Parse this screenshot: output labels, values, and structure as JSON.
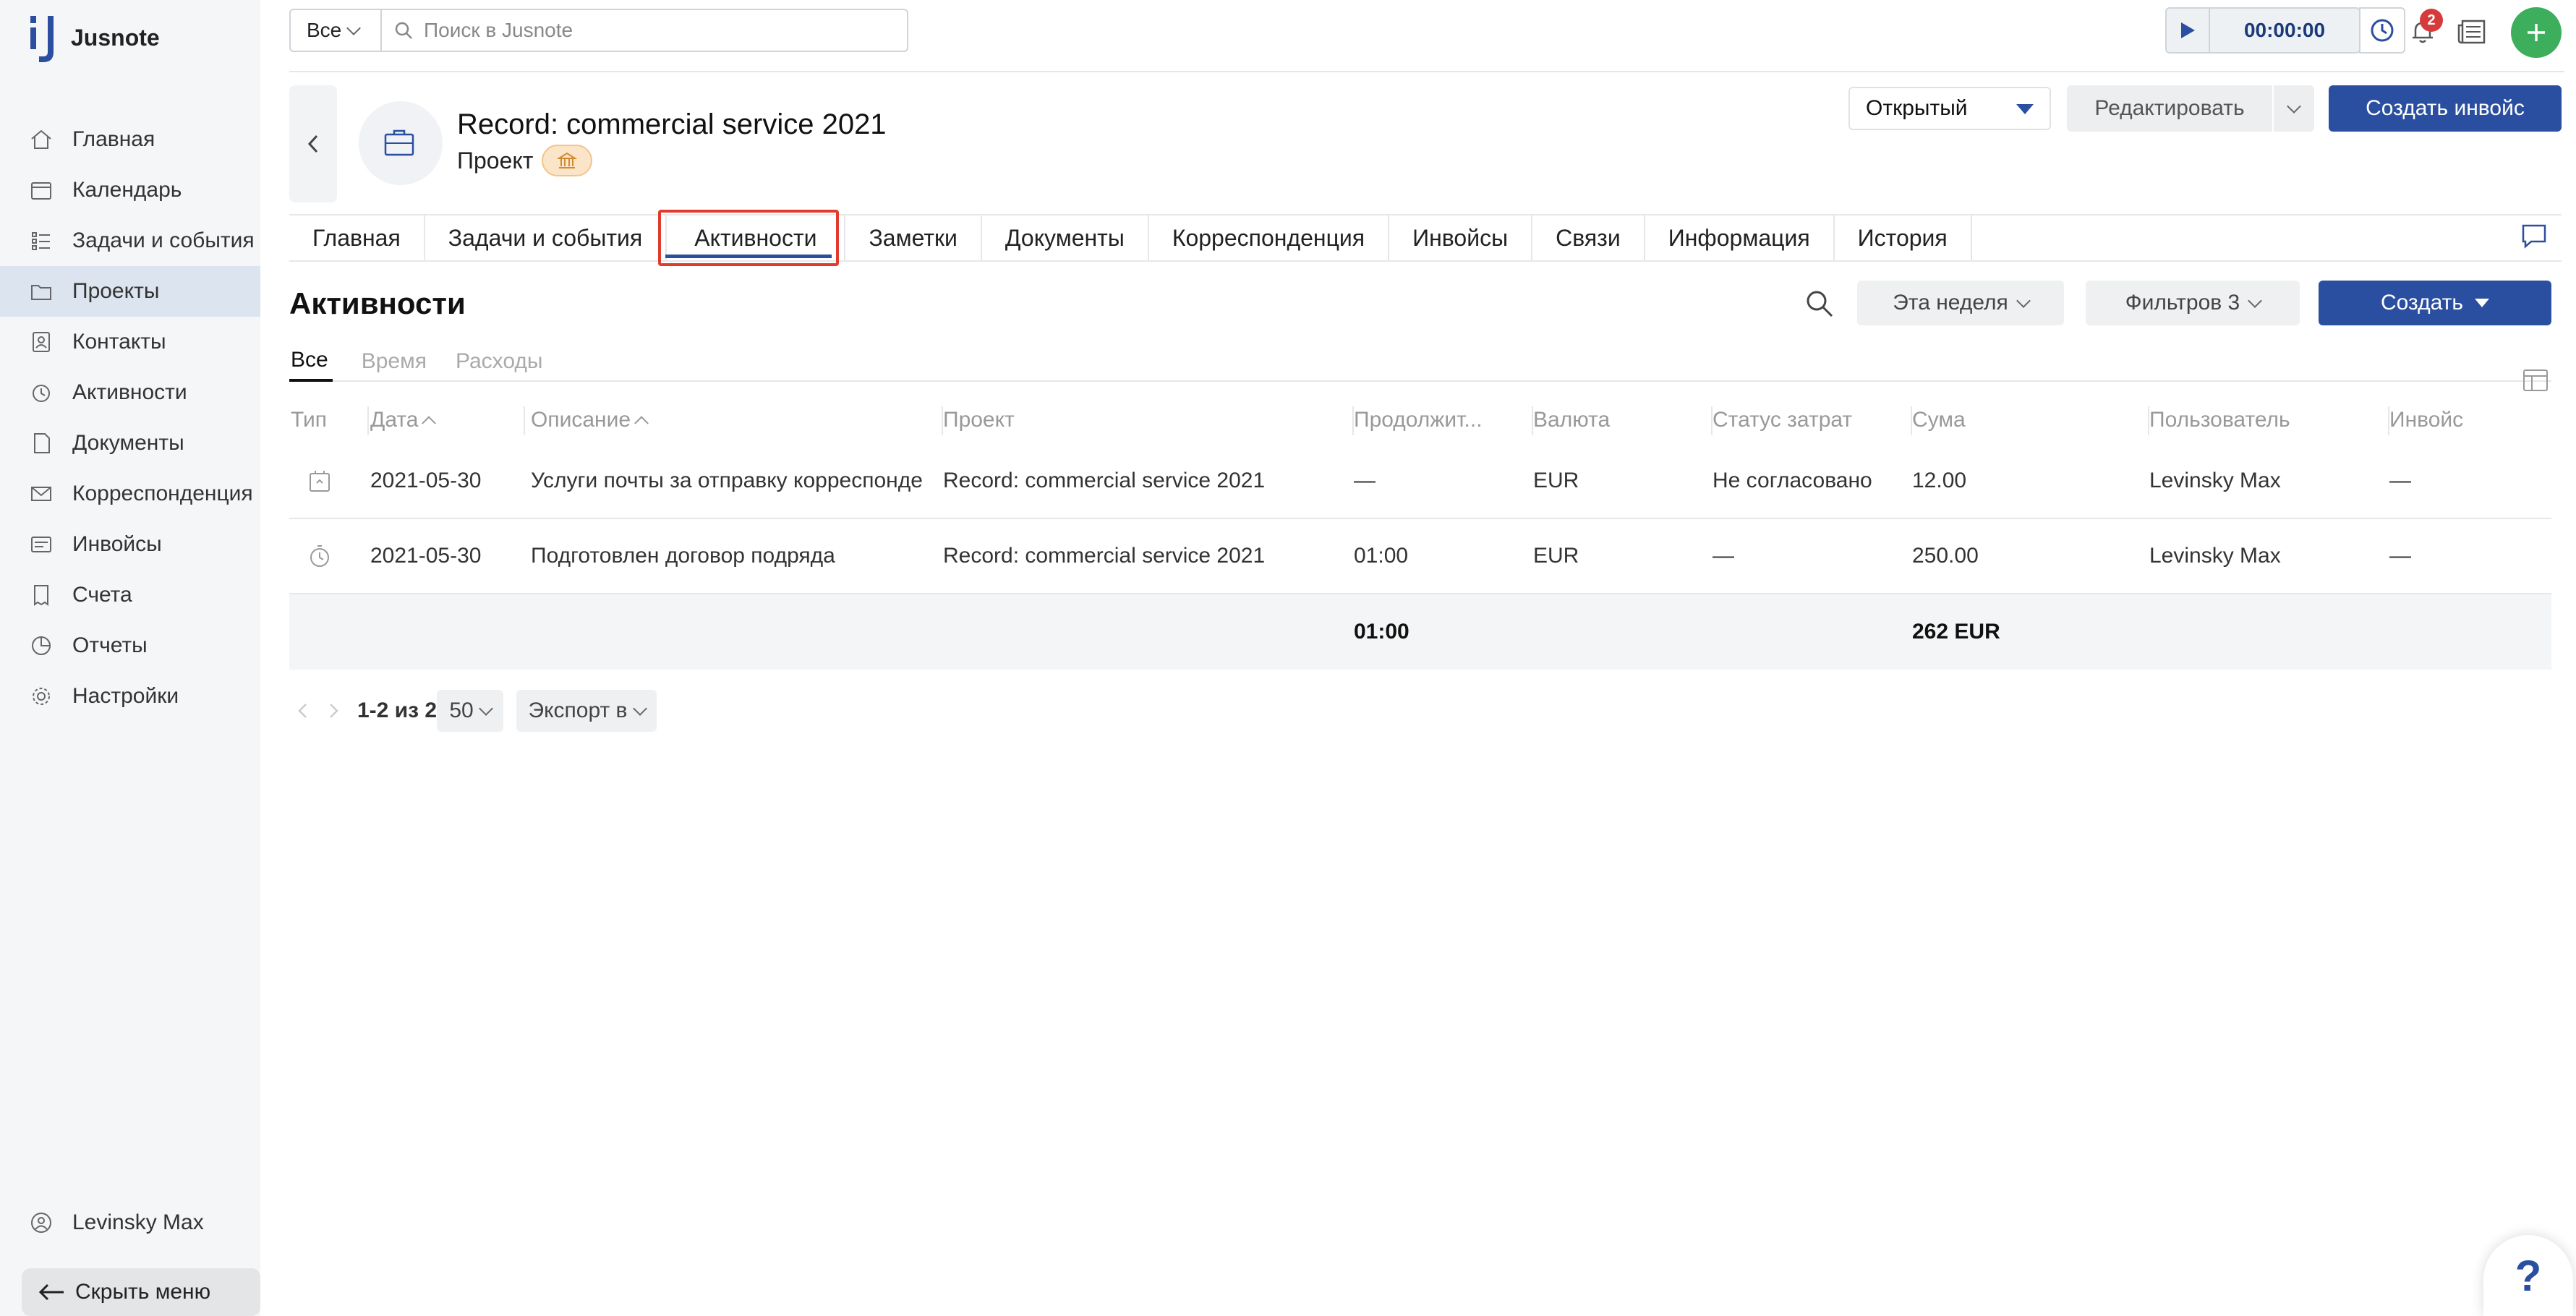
{
  "app": {
    "name": "Jusnote",
    "brand_color": "#2b4fa0",
    "accent_green": "#3cae5c"
  },
  "sidebar": {
    "items": [
      {
        "label": "Главная",
        "icon": "home-icon"
      },
      {
        "label": "Календарь",
        "icon": "calendar-icon"
      },
      {
        "label": "Задачи и события",
        "icon": "tasks-icon"
      },
      {
        "label": "Проекты",
        "icon": "folder-icon",
        "active": true
      },
      {
        "label": "Контакты",
        "icon": "contacts-icon"
      },
      {
        "label": "Активности",
        "icon": "activity-icon"
      },
      {
        "label": "Документы",
        "icon": "documents-icon"
      },
      {
        "label": "Корреспонденция",
        "icon": "mail-icon"
      },
      {
        "label": "Инвойсы",
        "icon": "invoice-icon"
      },
      {
        "label": "Счета",
        "icon": "bills-icon"
      },
      {
        "label": "Отчеты",
        "icon": "reports-icon"
      },
      {
        "label": "Настройки",
        "icon": "gear-icon"
      }
    ],
    "user": "Levinsky Max",
    "hide_menu": "Скрыть меню"
  },
  "topbar": {
    "scope": "Все",
    "search_placeholder": "Поиск в Jusnote",
    "timer": "00:00:00",
    "notifications": "2"
  },
  "header": {
    "title": "Record: commercial service 2021",
    "subtitle": "Проект",
    "status": "Открытый",
    "edit": "Редактировать",
    "create_invoice": "Создать инвойс"
  },
  "tabs": [
    "Главная",
    "Задачи и события",
    "Активности",
    "Заметки",
    "Документы",
    "Корреспонденция",
    "Инвойсы",
    "Связи",
    "Информация",
    "История"
  ],
  "activities": {
    "title": "Активности",
    "week": "Эта неделя",
    "filters": "Фильтров 3",
    "create": "Создать",
    "subtabs": [
      "Все",
      "Время",
      "Расходы"
    ],
    "columns": [
      "Тип",
      "Дата",
      "Описание",
      "Проект",
      "Продолжит...",
      "Валюта",
      "Статус затрат",
      "Сума",
      "Пользователь",
      "Инвойс"
    ],
    "rows": [
      {
        "type": "expense-icon",
        "date": "2021-05-30",
        "description": "Услуги почты за отправку корреспонде",
        "project": "Record: commercial service 2021",
        "duration": "—",
        "currency": "EUR",
        "status": "Не согласовано",
        "sum": "12.00",
        "user": "Levinsky Max",
        "invoice": "—"
      },
      {
        "type": "time-icon",
        "date": "2021-05-30",
        "description": "Подготовлен договор подряда",
        "project": "Record: commercial service 2021",
        "duration": "01:00",
        "currency": "EUR",
        "status": "—",
        "sum": "250.00",
        "user": "Levinsky Max",
        "invoice": "—"
      }
    ],
    "total": {
      "duration": "01:00",
      "sum": "262 EUR"
    }
  },
  "pagination": {
    "range": "1-2 из 2",
    "page_size": "50",
    "export": "Экспорт в"
  },
  "help": "?"
}
